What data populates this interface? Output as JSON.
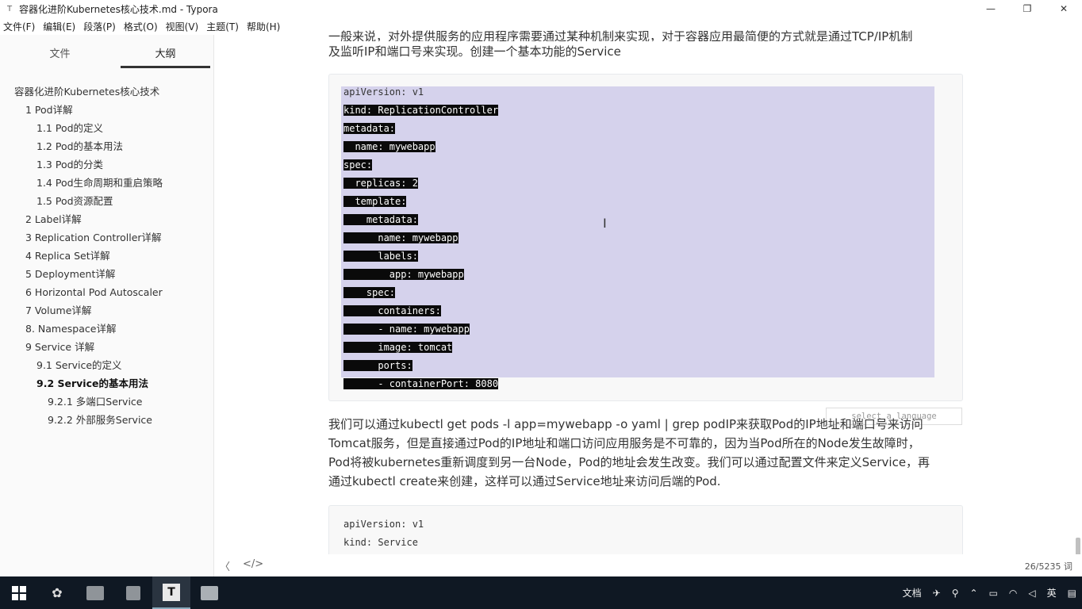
{
  "window": {
    "title": "容器化进阶Kubernetes核心技术.md - Typora",
    "controls": [
      "—",
      "❐",
      "✕"
    ]
  },
  "menu": [
    "文件(F)",
    "编辑(E)",
    "段落(P)",
    "格式(O)",
    "视图(V)",
    "主题(T)",
    "帮助(H)"
  ],
  "sidebar": {
    "tabs": [
      "文件",
      "大纲"
    ],
    "active_tab": "大纲",
    "outline": [
      {
        "label": "容器化进阶Kubernetes核心技术",
        "level": 1
      },
      {
        "label": "1 Pod详解",
        "level": 2
      },
      {
        "label": "1.1 Pod的定义",
        "level": 3
      },
      {
        "label": "1.2 Pod的基本用法",
        "level": 3
      },
      {
        "label": "1.3 Pod的分类",
        "level": 3
      },
      {
        "label": "1.4 Pod生命周期和重启策略",
        "level": 3
      },
      {
        "label": "1.5 Pod资源配置",
        "level": 3
      },
      {
        "label": "2 Label详解",
        "level": 2
      },
      {
        "label": "3 Replication Controller详解",
        "level": 2
      },
      {
        "label": "4 Replica Set详解",
        "level": 2
      },
      {
        "label": "5 Deployment详解",
        "level": 2
      },
      {
        "label": "6 Horizontal Pod Autoscaler",
        "level": 2
      },
      {
        "label": "7 Volume详解",
        "level": 2
      },
      {
        "label": "8. Namespace详解",
        "level": 2
      },
      {
        "label": "9 Service 详解",
        "level": 2
      },
      {
        "label": "9.1 Service的定义",
        "level": 3
      },
      {
        "label": "9.2 Service的基本用法",
        "level": 3,
        "active": true
      },
      {
        "label": "9.2.1 多端口Service",
        "level": 4
      },
      {
        "label": "9.2.2 外部服务Service",
        "level": 4
      }
    ]
  },
  "editor": {
    "top_partial": "一般来说，对外提供服务的应用程序需要通过某种机制来实现，对于容器应用最简便的方式就是通过TCP/IP机制",
    "intro": "及监听IP和端口号来实现。创建一个基本功能的Service",
    "code1": [
      "apiVersion: v1",
      "kind: ReplicationController",
      "metadata:",
      "  name: mywebapp",
      "spec:",
      "  replicas: 2",
      "  template:",
      "    metadata:",
      "      name: mywebapp",
      "      labels:",
      "        app: mywebapp",
      "    spec:",
      "      containers:",
      "      - name: mywebapp",
      "      image: tomcat",
      "      ports:",
      "      - containerPort: 8080"
    ],
    "lang_placeholder": "select a language",
    "body_lines": [
      "我们可以通过kubectl get pods -l app=mywebapp -o yaml | grep podIP来获取Pod的IP地址和端口号来访问",
      "Tomcat服务，但是直接通过Pod的IP地址和端口访问应用服务是不可靠的，因为当Pod所在的Node发生故障时，",
      "Pod将被kubernetes重新调度到另一台Node，Pod的地址会发生改变。我们可以通过配置文件来定义Service，再",
      "通过kubectl create来创建，这样可以通过Service地址来访问后端的Pod."
    ],
    "code2": [
      "apiVersion: v1",
      "kind: Service"
    ]
  },
  "statusbar": {
    "back": "〈",
    "source": "</>",
    "word_count": "26/5235 词"
  },
  "taskbar": {
    "tray_text": [
      "文档",
      "英"
    ],
    "time": ""
  }
}
